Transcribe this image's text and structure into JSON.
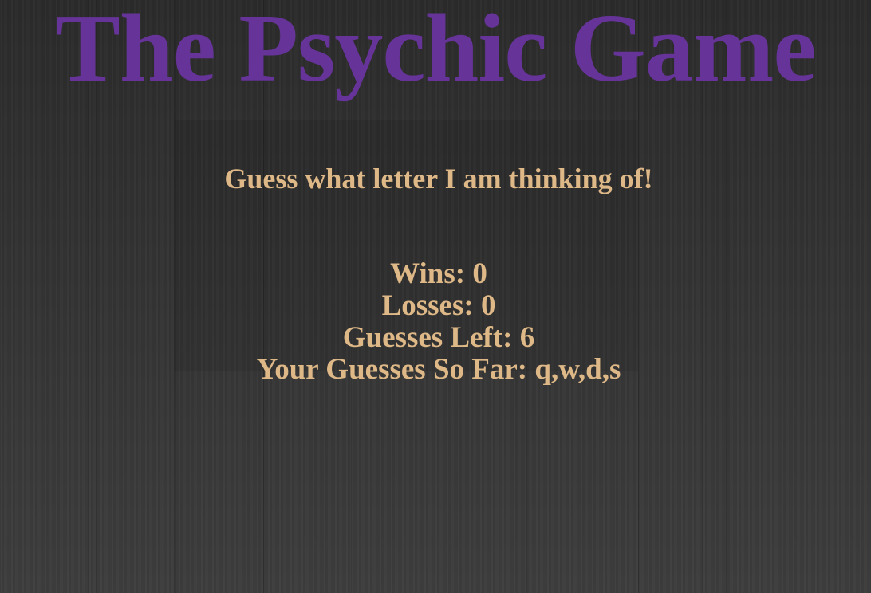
{
  "colors": {
    "title": "#663399",
    "text": "#deb887",
    "background": "#333333"
  },
  "game": {
    "title": "The Psychic Game",
    "prompt": "Guess what letter I am thinking of!",
    "wins_label": "Wins: ",
    "wins": "0",
    "losses_label": "Losses: ",
    "losses": "0",
    "guesses_left_label": "Guesses Left: ",
    "guesses_left": "6",
    "guesses_so_far_label": "Your Guesses So Far: ",
    "guesses_so_far": "q,w,d,s"
  }
}
